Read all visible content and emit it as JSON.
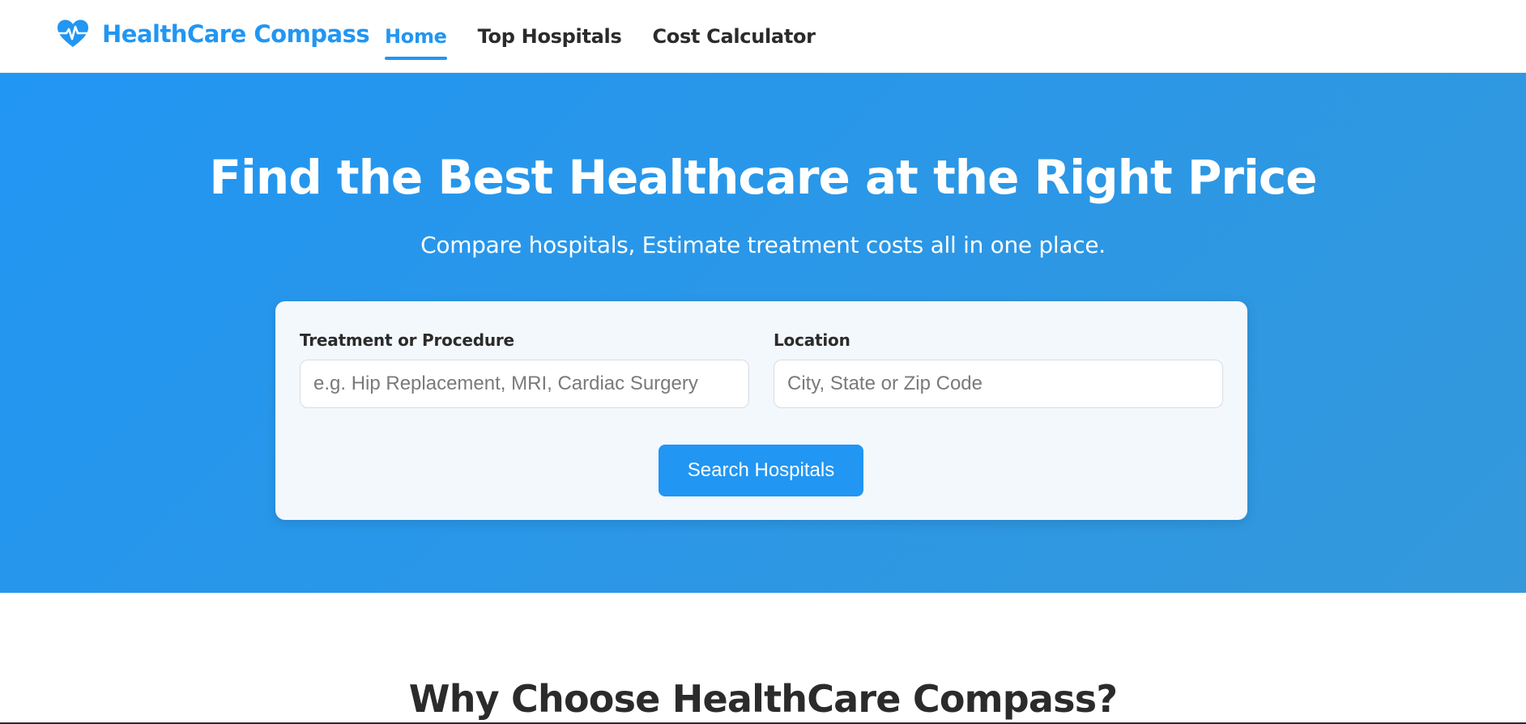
{
  "brand": {
    "name": "HealthCare Compass",
    "icon": "heart-pulse-icon",
    "color": "#2196f3"
  },
  "nav": {
    "items": [
      {
        "label": "Home",
        "active": true
      },
      {
        "label": "Top Hospitals",
        "active": false
      },
      {
        "label": "Cost Calculator",
        "active": false
      }
    ]
  },
  "hero": {
    "title": "Find the Best Healthcare at the Right Price",
    "subtitle": "Compare hospitals, Estimate treatment costs all in one place.",
    "background": "#2196f3"
  },
  "search": {
    "treatment": {
      "label": "Treatment or Procedure",
      "placeholder": "e.g. Hip Replacement, MRI, Cardiac Surgery",
      "value": ""
    },
    "location": {
      "label": "Location",
      "placeholder": "City, State or Zip Code",
      "value": ""
    },
    "button_label": "Search Hospitals"
  },
  "why": {
    "title": "Why Choose HealthCare Compass?"
  }
}
